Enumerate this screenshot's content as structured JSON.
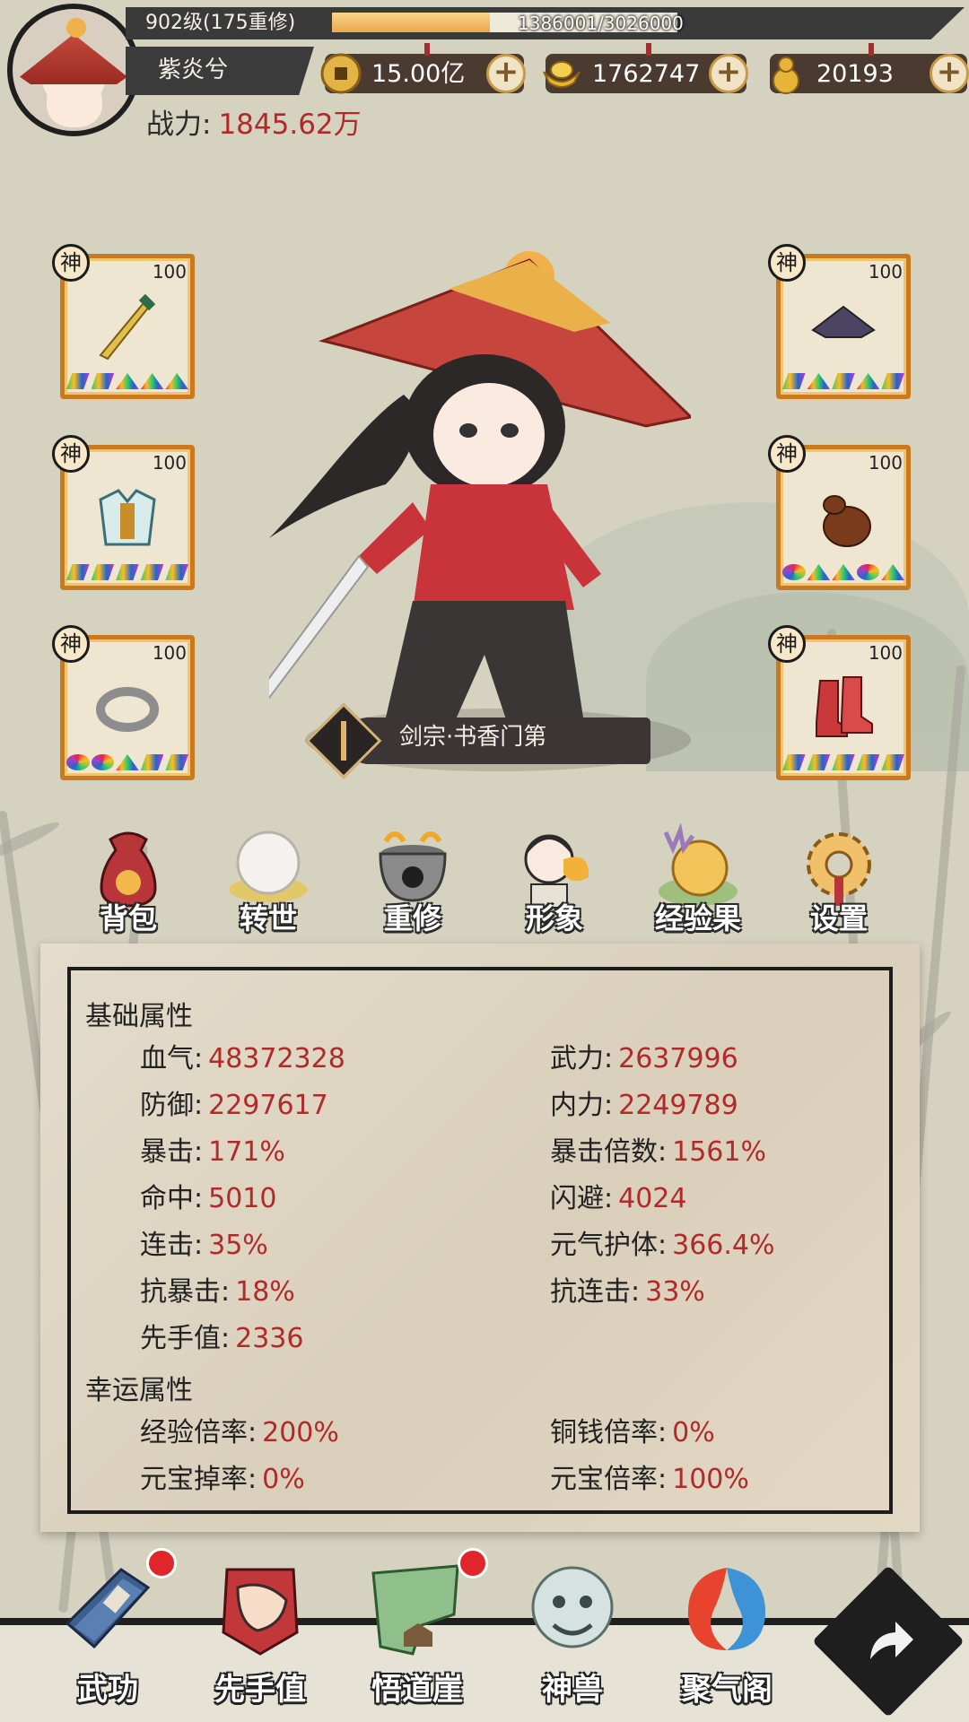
{
  "player": {
    "level_text": "902级(175重修)",
    "exp_text": "1386001/3026000",
    "exp_progress": 0.458,
    "name": "紫炎兮",
    "power_label": "战力:",
    "power_value": "1845.62万"
  },
  "currencies": [
    {
      "icon": "copper-coin-icon",
      "value": "15.00亿",
      "plus": "+"
    },
    {
      "icon": "gold-ingot-icon",
      "value": "1762747",
      "plus": "+"
    },
    {
      "icon": "gourd-icon",
      "value": "20193",
      "plus": "+"
    }
  ],
  "equipment": {
    "badge": "神",
    "level": "100",
    "left": [
      {
        "slot": "weapon",
        "icon": "sword-icon"
      },
      {
        "slot": "armor",
        "icon": "armor-icon"
      },
      {
        "slot": "ring",
        "icon": "ring-icon"
      }
    ],
    "right": [
      {
        "slot": "hat",
        "icon": "hat-icon"
      },
      {
        "slot": "gourd",
        "icon": "gourd-bag-icon"
      },
      {
        "slot": "boots",
        "icon": "boots-icon"
      }
    ]
  },
  "sect": {
    "label": "剑宗·书香门第"
  },
  "menu": [
    {
      "key": "bag",
      "label": "背包",
      "icon": "bag-icon"
    },
    {
      "key": "rebirth",
      "label": "转世",
      "icon": "pearl-icon"
    },
    {
      "key": "recultivate",
      "label": "重修",
      "icon": "cauldron-icon"
    },
    {
      "key": "appearance",
      "label": "形象",
      "icon": "portrait-icon"
    },
    {
      "key": "exp-fruit",
      "label": "经验果",
      "icon": "fruit-icon"
    },
    {
      "key": "settings",
      "label": "设置",
      "icon": "gear-icon"
    }
  ],
  "stats": {
    "basic_title": "基础属性",
    "basic": [
      {
        "label": "血气:",
        "value": "48372328"
      },
      {
        "label": "武力:",
        "value": "2637996"
      },
      {
        "label": "防御:",
        "value": "2297617"
      },
      {
        "label": "内力:",
        "value": "2249789"
      },
      {
        "label": "暴击:",
        "value": "171%"
      },
      {
        "label": "暴击倍数:",
        "value": "1561%"
      },
      {
        "label": "命中:",
        "value": "5010"
      },
      {
        "label": "闪避:",
        "value": "4024"
      },
      {
        "label": "连击:",
        "value": "35%"
      },
      {
        "label": "元气护体:",
        "value": "366.4%"
      },
      {
        "label": "抗暴击:",
        "value": "18%"
      },
      {
        "label": "抗连击:",
        "value": "33%"
      },
      {
        "label": "先手值:",
        "value": "2336"
      }
    ],
    "luck_title": "幸运属性",
    "luck": [
      {
        "label": "经验倍率:",
        "value": "200%"
      },
      {
        "label": "铜钱倍率:",
        "value": "0%"
      },
      {
        "label": "元宝掉率:",
        "value": "0%"
      },
      {
        "label": "元宝倍率:",
        "value": "100%"
      }
    ]
  },
  "nav": [
    {
      "key": "martial-arts",
      "label": "武功",
      "icon": "book-icon",
      "badge": true
    },
    {
      "key": "initiative",
      "label": "先手值",
      "icon": "fist-icon",
      "badge": false
    },
    {
      "key": "cliff",
      "label": "悟道崖",
      "icon": "cliff-icon",
      "badge": true
    },
    {
      "key": "beast",
      "label": "神兽",
      "icon": "beast-icon",
      "badge": false
    },
    {
      "key": "gather-qi",
      "label": "聚气阁",
      "icon": "swirl-icon",
      "badge": false
    }
  ],
  "colors": {
    "accent_red": "#b02a2a",
    "slot_orange": "#c97a1f",
    "notification": "#e0262a"
  }
}
